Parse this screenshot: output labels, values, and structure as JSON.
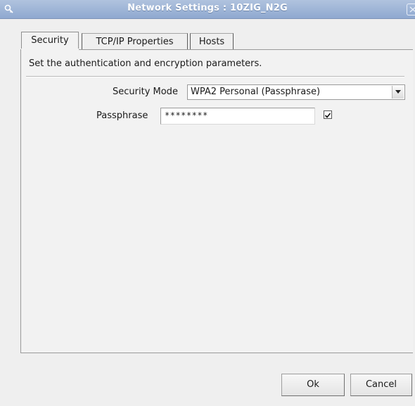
{
  "window": {
    "title": "Network Settings : 10ZIG_N2G",
    "icons": {
      "app": "key-search-icon",
      "close": "close-icon"
    }
  },
  "tabs": [
    {
      "label": "Security",
      "active": true
    },
    {
      "label": "TCP/IP Properties",
      "active": false
    },
    {
      "label": "Hosts",
      "active": false
    }
  ],
  "security": {
    "description": "Set the authentication and encryption parameters.",
    "mode_label": "Security Mode",
    "mode_value": "WPA2 Personal (Passphrase)",
    "passphrase_label": "Passphrase",
    "passphrase_value": "********",
    "show_passphrase_checked": true
  },
  "buttons": {
    "ok": "Ok",
    "cancel": "Cancel"
  }
}
